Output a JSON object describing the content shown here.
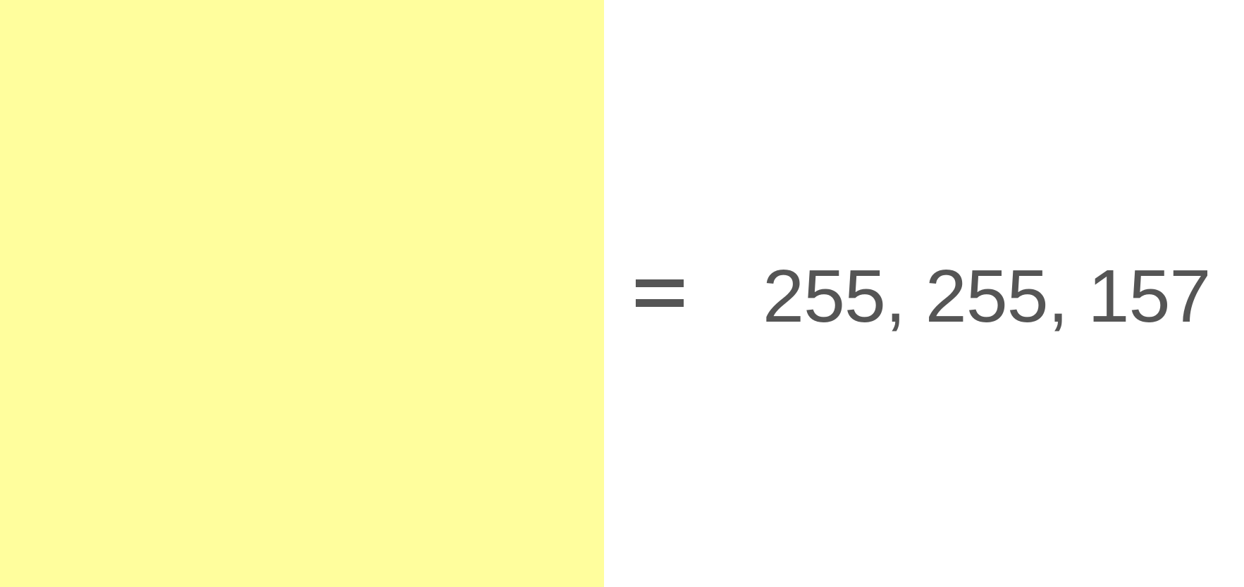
{
  "swatch": {
    "color": "#fffe9d"
  },
  "equals": {
    "glyph": "="
  },
  "rgb": {
    "text": "255, 255, 157"
  },
  "text_color": "#555555"
}
